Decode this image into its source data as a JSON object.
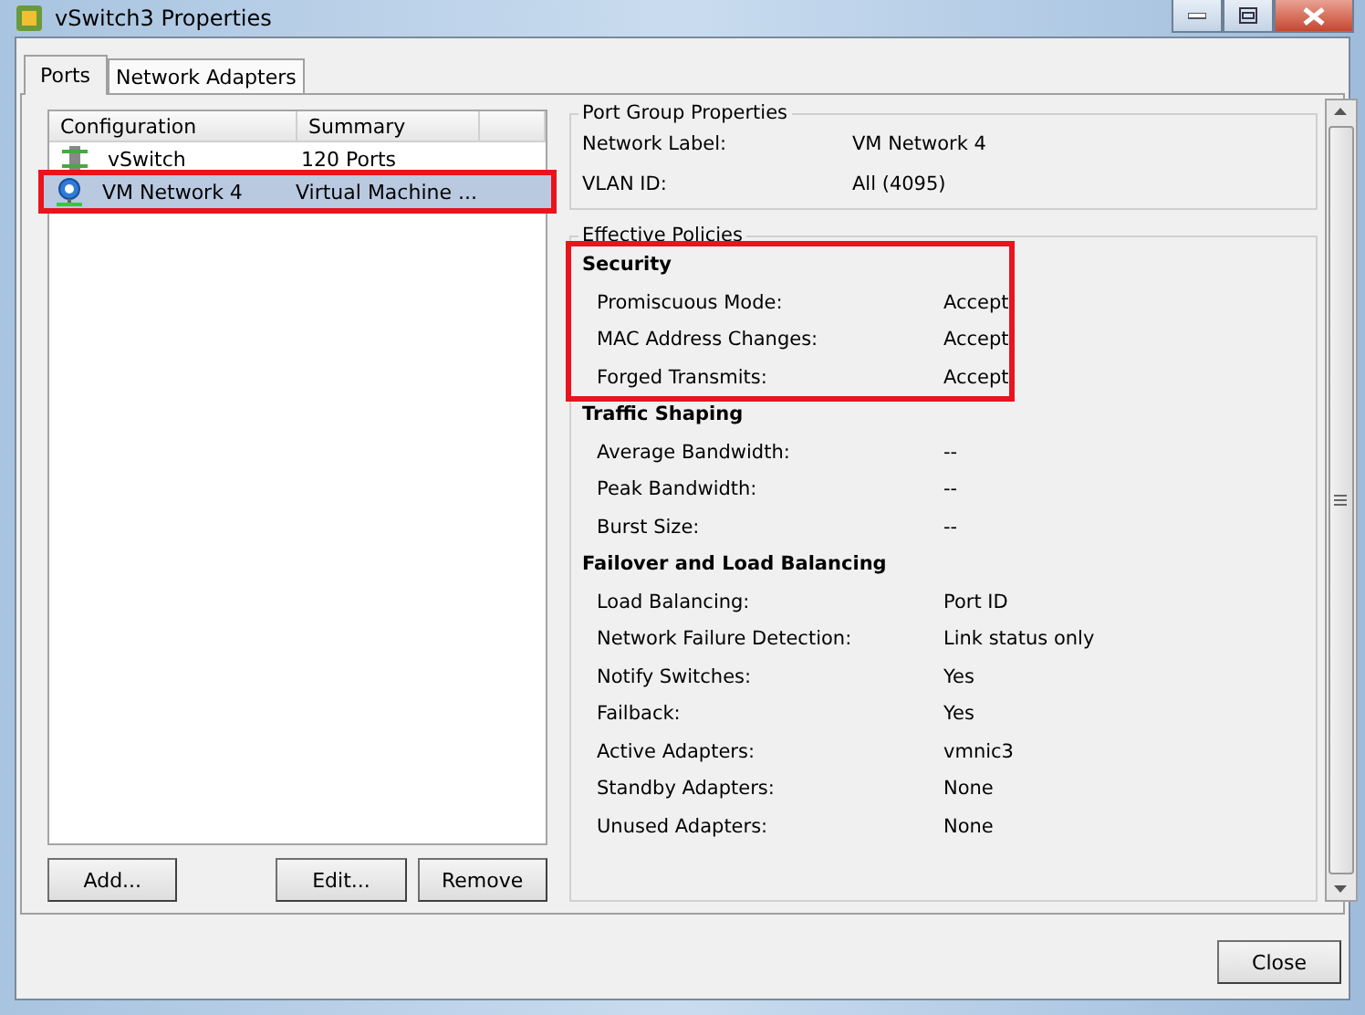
{
  "window": {
    "title": "vSwitch3 Properties"
  },
  "tabs": [
    {
      "label": "Ports",
      "selected": true
    },
    {
      "label": "Network Adapters",
      "selected": false
    }
  ],
  "ports": {
    "columns": [
      "Configuration",
      "Summary"
    ],
    "rows": [
      {
        "kind": "switch",
        "name": "vSwitch",
        "summary": "120 Ports",
        "selected": false,
        "highlighted": false
      },
      {
        "kind": "network",
        "name": "VM Network 4",
        "summary": "Virtual Machine ...",
        "selected": true,
        "highlighted": true
      }
    ],
    "buttons": [
      "Add...",
      "Edit...",
      "Remove"
    ]
  },
  "port_group": {
    "title": "Port Group Properties",
    "fields": [
      {
        "label": "Network Label:",
        "value": "VM Network 4"
      },
      {
        "label": "VLAN ID:",
        "value": "All (4095)"
      }
    ]
  },
  "policies": {
    "title": "Effective Policies",
    "sections": [
      {
        "title": "Security",
        "highlighted": true,
        "rows": [
          {
            "label": "Promiscuous Mode:",
            "value": "Accept"
          },
          {
            "label": "MAC Address Changes:",
            "value": "Accept"
          },
          {
            "label": "Forged Transmits:",
            "value": "Accept"
          }
        ]
      },
      {
        "title": "Traffic Shaping",
        "highlighted": false,
        "rows": [
          {
            "label": "Average Bandwidth:",
            "value": "--"
          },
          {
            "label": "Peak Bandwidth:",
            "value": "--"
          },
          {
            "label": "Burst Size:",
            "value": "--"
          }
        ]
      },
      {
        "title": "Failover and Load Balancing",
        "highlighted": false,
        "rows": [
          {
            "label": "Load Balancing:",
            "value": "Port ID"
          },
          {
            "label": "Network Failure Detection:",
            "value": "Link status only"
          },
          {
            "label": "Notify Switches:",
            "value": "Yes"
          },
          {
            "label": "Failback:",
            "value": "Yes"
          },
          {
            "label": "Active Adapters:",
            "value": "vmnic3"
          },
          {
            "label": "Standby Adapters:",
            "value": "None"
          },
          {
            "label": "Unused Adapters:",
            "value": "None"
          }
        ]
      }
    ]
  },
  "close_button": "Close"
}
